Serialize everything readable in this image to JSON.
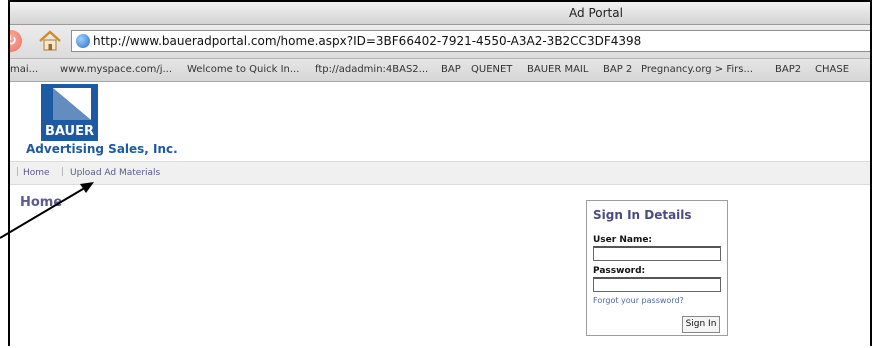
{
  "window": {
    "title": "Ad Portal"
  },
  "toolbar": {
    "url": "http://www.baueradportal.com/home.aspx?ID=3BF66402-7921-4550-A3A2-3B2CC3DF4398"
  },
  "bookmarks": [
    "mai...",
    "www.myspace.com/j...",
    "Welcome to Quick In...",
    "ftp://adadmin:4BAS2...",
    "BAP",
    "QUENET",
    "BAUER MAIL",
    "BAP 2",
    "Pregnancy.org > Firs...",
    "BAP2",
    "CHASE"
  ],
  "site": {
    "logo_text": "BAUER",
    "tagline": "Advertising Sales, Inc."
  },
  "nav": {
    "home": "Home",
    "upload": "Upload Ad Materials"
  },
  "main": {
    "heading": "Home"
  },
  "signin": {
    "title": "Sign In Details",
    "username_label": "User Name:",
    "password_label": "Password:",
    "forgot": "Forgot your password?",
    "button": "Sign In"
  }
}
